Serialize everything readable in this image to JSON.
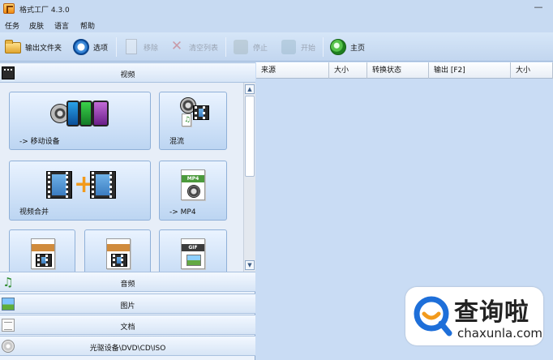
{
  "window": {
    "title": "格式工厂 4.3.0",
    "minimize_glyph": "—"
  },
  "menu": [
    "任务",
    "皮肤",
    "语言",
    "帮助"
  ],
  "toolbar": {
    "output_folder": "输出文件夹",
    "options": "选项",
    "remove": "移除",
    "clear_list": "清空列表",
    "stop": "停止",
    "start": "开始",
    "home": "主页"
  },
  "categories": {
    "video": "视频",
    "audio": "音频",
    "image": "图片",
    "document": "文档",
    "disc": "光驱设备\\DVD\\CD\\ISO"
  },
  "tiles": {
    "mobile": "-> 移动设备",
    "mux": "混流",
    "merge": "视频合并",
    "mp4": "-> MP4",
    "mp4_tag": "MP4",
    "gif_tag": "GIF"
  },
  "task_columns": [
    "来源",
    "大小",
    "转换状态",
    "输出 [F2]",
    "大小"
  ],
  "icons": {
    "toolbar": [
      "folder-icon",
      "options-icon",
      "remove-icon",
      "clear-list-icon",
      "stop-icon",
      "start-icon",
      "home-icon"
    ],
    "categories": [
      "video-icon",
      "music-note-icon",
      "picture-icon",
      "document-icon",
      "disc-icon"
    ]
  },
  "colors": {
    "background": "#c9dcf4",
    "tile_gradient_top": "#eaf3ff",
    "tile_gradient_bottom": "#bcd5f2",
    "accent_orange": "#f29a1c",
    "watermark_blue": "#1e6fd9"
  },
  "watermark": {
    "chinese": "查询啦",
    "domain": "chaxunla.com"
  }
}
